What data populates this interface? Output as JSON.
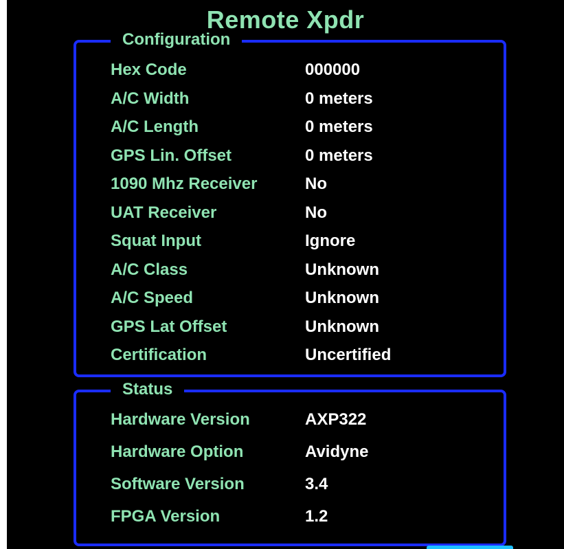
{
  "title": "Remote Xpdr",
  "configuration": {
    "heading": "Configuration",
    "rows": [
      {
        "label": "Hex Code",
        "value": "000000"
      },
      {
        "label": "A/C Width",
        "value": "0 meters"
      },
      {
        "label": "A/C Length",
        "value": "0 meters"
      },
      {
        "label": "GPS Lin. Offset",
        "value": "0 meters"
      },
      {
        "label": "1090 Mhz Receiver",
        "value": "No"
      },
      {
        "label": "UAT Receiver",
        "value": "No"
      },
      {
        "label": "Squat Input",
        "value": "Ignore"
      },
      {
        "label": "A/C Class",
        "value": "Unknown"
      },
      {
        "label": "A/C Speed",
        "value": "Unknown"
      },
      {
        "label": "GPS Lat Offset",
        "value": "Unknown"
      },
      {
        "label": "Certification",
        "value": "Uncertified"
      }
    ]
  },
  "status": {
    "heading": "Status",
    "rows": [
      {
        "label": "Hardware Version",
        "value": "AXP322"
      },
      {
        "label": "Hardware Option",
        "value": "Avidyne"
      },
      {
        "label": "Software Version",
        "value": "3.4"
      },
      {
        "label": "FPGA Version",
        "value": "1.2"
      }
    ]
  },
  "colors": {
    "label": "#8fe3b2",
    "value": "#ffffff",
    "border": "#1a2cff",
    "background": "#000000",
    "tab": "#1ec0ff"
  }
}
